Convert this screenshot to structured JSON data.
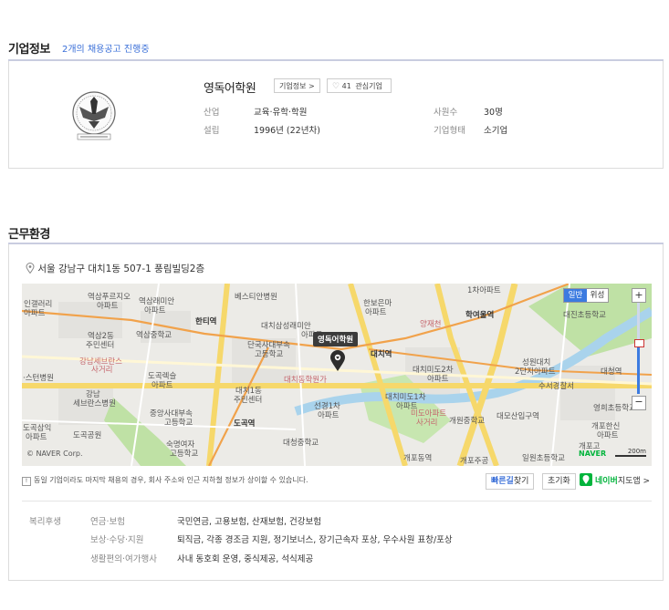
{
  "company_section": {
    "title": "기업정보",
    "job_postings_link": "2개의 채용공고 진행중"
  },
  "company": {
    "name": "영독어학원",
    "info_button": "기업정보 >",
    "favorite_count": "41",
    "favorite_label": "관심기업",
    "industry_label": "산업",
    "industry_value": "교육·유학·학원",
    "founded_label": "설립",
    "founded_value": "1996년 (22년차)",
    "employees_label": "사원수",
    "employees_value": "30명",
    "type_label": "기업형태",
    "type_value": "소기업"
  },
  "work_section": {
    "title": "근무환경",
    "address": "서울 강남구 대치1동 507-1 풍림빌딩2층"
  },
  "map": {
    "map_type_normal": "일반",
    "map_type_satellite": "위성",
    "marker_label": "영독어학원",
    "copyright": "© NAVER Corp.",
    "naver_logo": "NAVER",
    "scale": "200m",
    "zoom_in": "+",
    "zoom_out": "−",
    "labels": {
      "l1": "인갤러리",
      "l2": "아파트",
      "l3": "역삼푸르지오",
      "l4": "아파트",
      "l5": "역삼래미안",
      "l6": "아파트",
      "l7": "베스티안병원",
      "l8": "한보은마",
      "l9": "아파트",
      "l10": "1차아파트",
      "l11": "역삼2동",
      "l12": "주민센터",
      "l13": "역삼중학교",
      "l14": "한티역",
      "l15": "대치삼성래미안",
      "l16": "아파트",
      "l17": "학여울역",
      "l18": "대진초등학교",
      "l19": "단국사대부속",
      "l20": "고등학교",
      "l21": "강남세브란스",
      "l22": "사거리",
      "l23": "도곡렉슬",
      "l24": "아파트",
      "l25": "대치역",
      "l26": "성원대치",
      "l27": "2단지아파트",
      "l28": "대청역",
      "l29": "·스턴병원",
      "l30": "대치동학원가",
      "l31": "대치미도2차",
      "l32": "아파트",
      "l33": "수서경찰서",
      "l34": "대치1동",
      "l35": "주민센터",
      "l36": "강남",
      "l37": "세브란스병원",
      "l38": "대치미도1차",
      "l39": "아파트",
      "l40": "영희초등학교",
      "l41": "중앙사대부속",
      "l42": "고등학교",
      "l43": "선경1차",
      "l44": "아파트",
      "l45": "미도아파트",
      "l46": "사거리",
      "l47": "개원중학교",
      "l48": "대모산입구역",
      "l49": "개포한신",
      "l50": "아파트",
      "l51": "도곡삼익",
      "l52": "아파트",
      "l53": "도곡공원",
      "l54": "도곡역",
      "l55": "숙명여자",
      "l56": "고등학교",
      "l57": "대청중학교",
      "l58": "개포동역",
      "l59": "일원초등학교",
      "l60": "개포주공",
      "l61": "개포고",
      "l62": "양재천"
    }
  },
  "map_footer": {
    "notice": "동일 기업이라도 마지막 채용의 경우, 회사 주소와 인근 지하철 정보가 상이할 수 있습니다.",
    "route_button_highlight": "빠른길",
    "route_button_rest": "찾기",
    "reset_button": "초기화",
    "naver_map_prefix": "네이버",
    "naver_map_suffix": "지도앱 >"
  },
  "benefits": {
    "category": "복리후생",
    "rows": [
      {
        "label": "연금·보험",
        "value": "국민연금, 고용보험, 산재보험, 건강보험"
      },
      {
        "label": "보상·수당·지원",
        "value": "퇴직금, 각종 경조금 지원, 정기보너스, 장기근속자 포상, 우수사원 표창/포상"
      },
      {
        "label": "생활편의·여가행사",
        "value": "사내 동호회 운영, 중식제공, 석식제공"
      }
    ]
  },
  "colors": {
    "accent": "#3a6fd8",
    "title_rule": "#c9cde0",
    "map_road_orange": "#f1a24b",
    "map_road_yellow": "#f6d86b",
    "map_park": "#bfe1a5",
    "map_river": "#a9d3ec",
    "naver_green": "#02b43c"
  }
}
